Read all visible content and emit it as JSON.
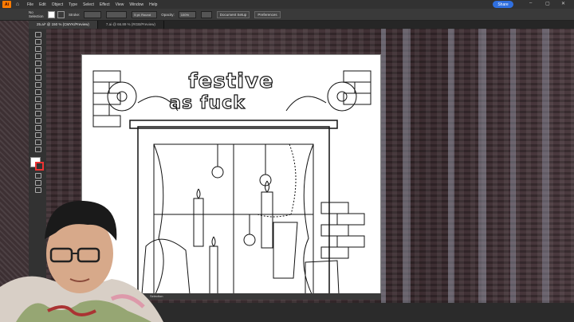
{
  "menubar": {
    "logo": "Ai",
    "items": [
      "File",
      "Edit",
      "Object",
      "Type",
      "Select",
      "Effect",
      "View",
      "Window",
      "Help"
    ],
    "share_label": "Share"
  },
  "controlbar": {
    "selection_status": "No Selection",
    "stroke_label": "Stroke:",
    "brush_value": "5 pt. Round",
    "opacity_label": "Opacity:",
    "opacity_value": "100%",
    "document_setup": "Document Setup",
    "preferences": "Preferences"
  },
  "tabs": [
    {
      "label": "25.ai* @ 150 % (CMYK/Preview)",
      "active": true
    },
    {
      "label": "7.ai @ 66.89 % (RGB/Preview)",
      "active": false
    }
  ],
  "artwork": {
    "title_line1": "festive",
    "title_line2": "as fuck"
  },
  "statusbar": {
    "label": "Selection"
  },
  "colors": {
    "accent": "#ff7c00",
    "share": "#2f6fdf"
  }
}
